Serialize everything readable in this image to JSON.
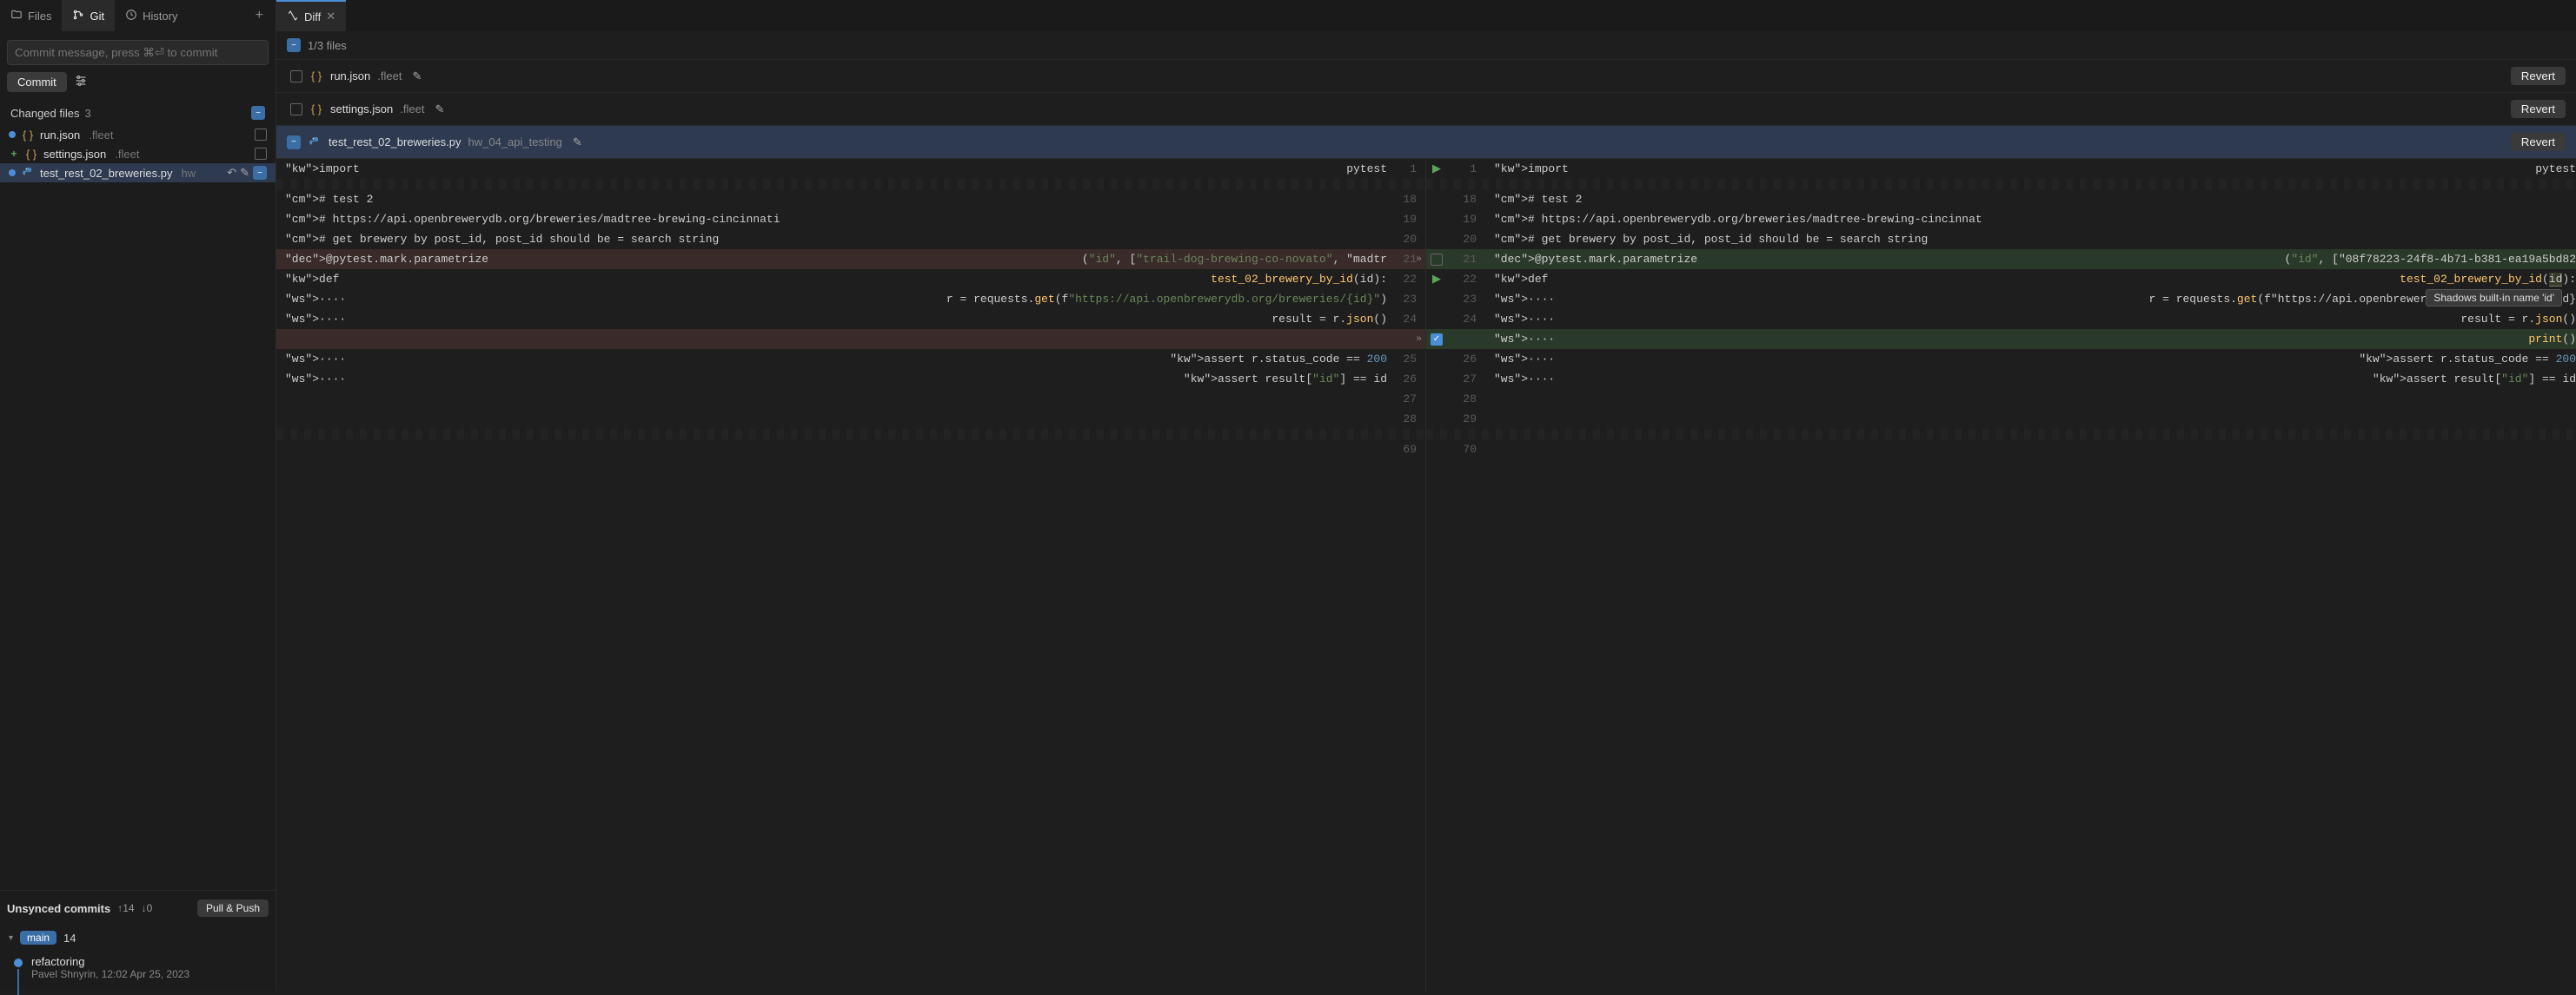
{
  "sidebar": {
    "tabs": {
      "files": "Files",
      "git": "Git",
      "history": "History"
    },
    "commit_placeholder": "Commit message, press ⌘⏎ to commit",
    "commit_btn": "Commit",
    "changed_files": {
      "title": "Changed files",
      "count": "3"
    },
    "files": [
      {
        "name": "run.json",
        "ext": ".fleet",
        "status": "mod",
        "icon": "json"
      },
      {
        "name": "settings.json",
        "ext": ".fleet",
        "status": "add",
        "icon": "json"
      },
      {
        "name": "test_rest_02_breweries.py",
        "ext": "hw",
        "status": "mod",
        "icon": "py",
        "selected": true
      }
    ],
    "unsynced": {
      "title": "Unsynced commits",
      "up": "↑14",
      "down": "↓0",
      "pull_push": "Pull & Push",
      "branch": "main",
      "branch_count": "14",
      "commit": {
        "message": "refactoring",
        "author": "Pavel Shnyrin, 12:02 Apr 25, 2023"
      }
    }
  },
  "main": {
    "tab": {
      "label": "Diff"
    },
    "summary": "1/3 files",
    "file_headers": [
      {
        "name": "run.json",
        "sub": ".fleet",
        "icon": "json",
        "revert": "Revert"
      },
      {
        "name": "settings.json",
        "sub": ".fleet",
        "icon": "json",
        "revert": "Revert"
      },
      {
        "name": "test_rest_02_breweries.py",
        "sub": "hw_04_api_testing",
        "icon": "py",
        "revert": "Revert",
        "active": true
      }
    ],
    "tooltip": "Shadows built-in name 'id'",
    "left": {
      "lines": [
        {
          "n": "1",
          "raw": "import pytest"
        },
        {
          "n": "",
          "fold": true
        },
        {
          "n": "18",
          "raw": "# test 2"
        },
        {
          "n": "19",
          "raw": "# https://api.openbrewerydb.org/breweries/madtree-brewing-cincinnati"
        },
        {
          "n": "20",
          "raw": "# get brewery by post_id, post_id should be = search string"
        },
        {
          "n": "21",
          "raw": "@pytest.mark.parametrize(\"id\", [\"trail-dog-brewing-co-novato\", \"madtr",
          "del": true,
          "expand": true
        },
        {
          "n": "22",
          "raw": "def test_02_brewery_by_id(id):"
        },
        {
          "n": "23",
          "raw": "····r = requests.get(f\"https://api.openbrewerydb.org/breweries/{id}\")"
        },
        {
          "n": "24",
          "raw": "····result = r.json()"
        },
        {
          "n": "",
          "raw": "",
          "del": true,
          "expand": true
        },
        {
          "n": "25",
          "raw": "····assert r.status_code == 200"
        },
        {
          "n": "26",
          "raw": "····assert result[\"id\"] == id"
        },
        {
          "n": "27",
          "raw": ""
        },
        {
          "n": "28",
          "raw": ""
        },
        {
          "n": "",
          "fold": true
        },
        {
          "n": "69",
          "raw": ""
        }
      ]
    },
    "right": {
      "lines": [
        {
          "n": "1",
          "raw": "import pytest",
          "gutter": "play"
        },
        {
          "n": "",
          "fold": true
        },
        {
          "n": "18",
          "raw": "# test 2"
        },
        {
          "n": "19",
          "raw": "# https://api.openbrewerydb.org/breweries/madtree-brewing-cincinnat"
        },
        {
          "n": "20",
          "raw": "# get brewery by post_id, post_id should be = search string"
        },
        {
          "n": "21",
          "raw": "@pytest.mark.parametrize(\"id\", [\"08f78223-24f8-4b71-b381-ea19a5bd82",
          "add": true,
          "gutter": "chk-empty"
        },
        {
          "n": "22",
          "raw": "def test_02_brewery_by_id(id):",
          "gutter": "play",
          "param_hl": true
        },
        {
          "n": "23",
          "raw": "····r = requests.get(f\"https://api.openbrewerydb.org/breweries/{id}"
        },
        {
          "n": "24",
          "raw": "····result = r.json()"
        },
        {
          "n": "",
          "raw": "····print()",
          "add": true,
          "gutter": "chk-blue"
        },
        {
          "n": "26",
          "raw": "····assert r.status_code == 200"
        },
        {
          "n": "27",
          "raw": "····assert result[\"id\"] == id"
        },
        {
          "n": "28",
          "raw": ""
        },
        {
          "n": "29",
          "raw": ""
        },
        {
          "n": "",
          "fold": true
        },
        {
          "n": "70",
          "raw": ""
        }
      ]
    }
  }
}
